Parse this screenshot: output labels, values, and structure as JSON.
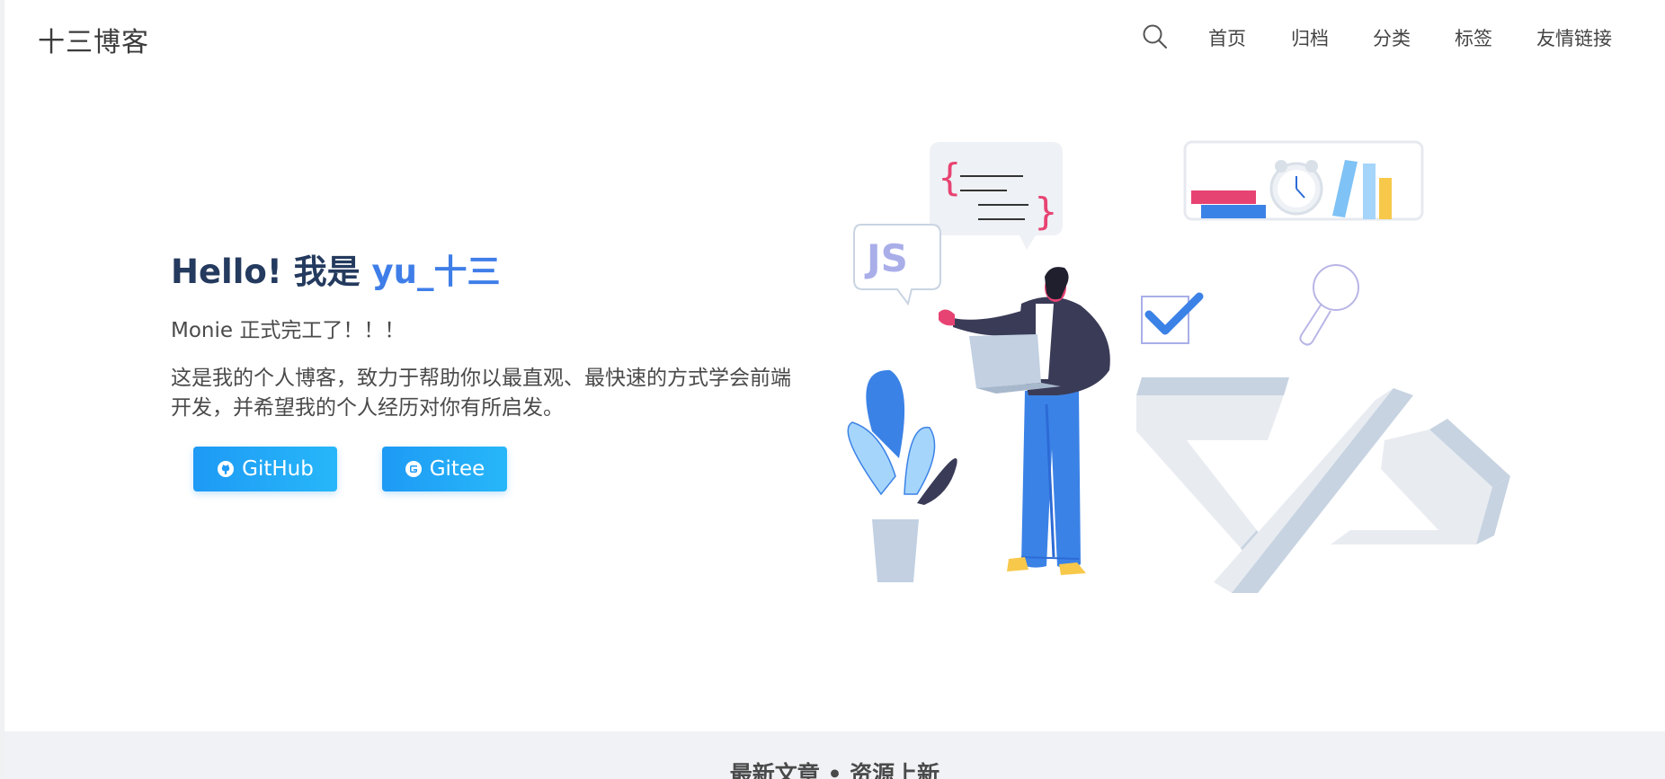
{
  "header": {
    "brand": "十三博客",
    "nav": [
      "首页",
      "归档",
      "分类",
      "标签",
      "友情链接"
    ]
  },
  "hero": {
    "greeting": "Hello! 我是 ",
    "name": "yu_十三",
    "subtitle": "Monie 正式完工了！！！",
    "description": "这是我的个人博客，致力于帮助你以最直观、最快速的方式学会前端开发，并希望我的个人经历对你有所启发。",
    "buttons": {
      "github": "GitHub",
      "gitee": "Gitee"
    }
  },
  "illustration": {
    "js_label": "JS"
  },
  "section": {
    "title": "最新文章 • 资源上新"
  },
  "colors": {
    "accent": "#3f7ee8",
    "button": "#1e9af5",
    "title": "#243a5e"
  }
}
